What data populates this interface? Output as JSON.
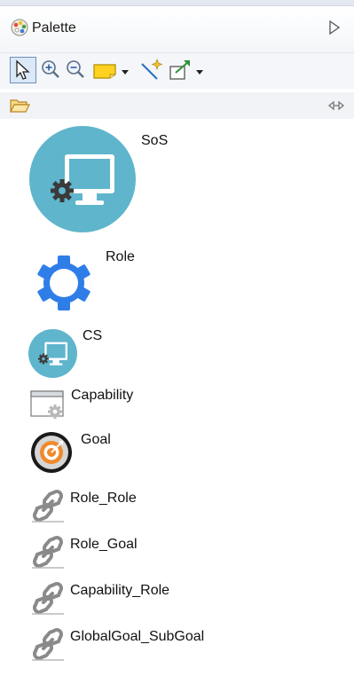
{
  "palette": {
    "title": "Palette"
  },
  "colors": {
    "accent_blue": "#2f7ee8",
    "monitor_teal": "#5fb5cc"
  },
  "icons": {
    "palette_header": "palette-icon",
    "collapse": "triangle-right-icon",
    "toolbar": [
      "select-arrow-icon",
      "zoom-in-icon",
      "zoom-out-icon",
      "note-icon",
      "dropdown-arrow-icon",
      "connection-icon",
      "note-attachment-icon",
      "dropdown-arrow-icon"
    ],
    "drawer": "folder-open-icon",
    "expand": "double-arrow-icon"
  },
  "entries": [
    {
      "label": "SoS",
      "icon": "sos-monitor-icon"
    },
    {
      "label": "Role",
      "icon": "gear-icon"
    },
    {
      "label": "CS",
      "icon": "cs-monitor-icon"
    },
    {
      "label": "Capability",
      "icon": "window-gear-icon"
    },
    {
      "label": "Goal",
      "icon": "target-icon"
    },
    {
      "label": "Role_Role",
      "icon": "link-icon"
    },
    {
      "label": "Role_Goal",
      "icon": "link-icon"
    },
    {
      "label": "Capability_Role",
      "icon": "link-icon"
    },
    {
      "label": "GlobalGoal_SubGoal",
      "icon": "link-icon"
    }
  ]
}
